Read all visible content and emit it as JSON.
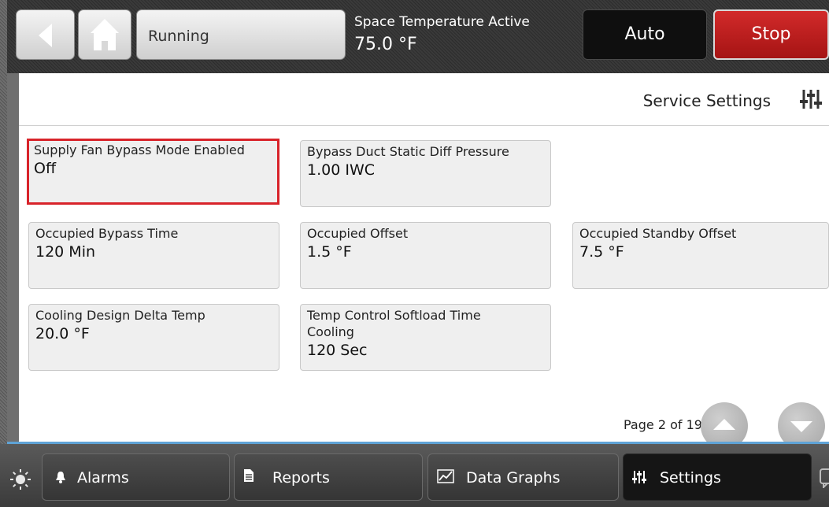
{
  "header": {
    "status": "Running",
    "temp_label": "Space Temperature Active",
    "temp_value": "75.0 °F",
    "auto_label": "Auto",
    "stop_label": "Stop"
  },
  "panel": {
    "title": "Service Settings",
    "tiles": [
      {
        "label": "Supply Fan Bypass Mode Enabled",
        "value": "Off"
      },
      {
        "label": "Bypass Duct Static Diff Pressure",
        "value": "1.00 IWC"
      },
      {
        "label": "Occupied Bypass Time",
        "value": "120 Min"
      },
      {
        "label": "Occupied Offset",
        "value": "1.5 °F"
      },
      {
        "label": "Occupied Standby Offset",
        "value": "7.5 °F"
      },
      {
        "label": "Cooling Design Delta Temp",
        "value": "20.0 °F"
      },
      {
        "label": "Temp Control Softload Time Cooling",
        "value": "120 Sec"
      }
    ],
    "page_text": "Page 2 of 19"
  },
  "nav": {
    "alarms": "Alarms",
    "reports": "Reports",
    "data_graphs": "Data Graphs",
    "settings": "Settings"
  },
  "colors": {
    "highlight_border": "#d8232a",
    "stop_red": "#c01f1f",
    "accent_line": "#5fa3d6"
  }
}
